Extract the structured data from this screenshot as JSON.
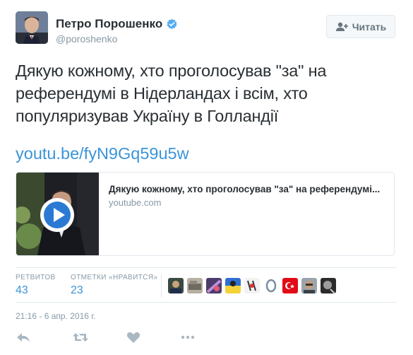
{
  "user": {
    "name": "Петро Порошенко",
    "handle": "@poroshenko",
    "verified": true,
    "avatar_icon": "avatar-photo"
  },
  "follow_button": {
    "label": "Читать",
    "icon": "follow-user-icon"
  },
  "tweet": {
    "text": "Дякую кожному, хто проголосував \"за\" на референдумі в Нідерландах і всім, хто популяризував Україну в Голландії",
    "link": "youtu.be/fyN9Gq59u5w"
  },
  "card": {
    "title": "Дякую кожному, хто проголосував \"за\" на референдумі...",
    "domain": "youtube.com",
    "thumbnail_icon": "video-thumbnail",
    "play_icon": "play-icon"
  },
  "stats": {
    "retweets_label": "РЕТВИТОВ",
    "retweets_value": "43",
    "likes_label": "ОТМЕТКИ «НРАВИТСЯ»",
    "likes_value": "23",
    "likers": [
      "liker-avatar",
      "liker-avatar",
      "liker-avatar",
      "liker-avatar",
      "liker-avatar",
      "liker-avatar",
      "liker-avatar",
      "liker-avatar",
      "liker-avatar",
      "liker-avatar"
    ]
  },
  "timestamp": "21:16 - 6 апр. 2016 г.",
  "actions": [
    "reply-icon",
    "retweet-icon",
    "like-icon",
    "more-icon"
  ],
  "colors": {
    "link": "#3b94d9",
    "muted": "#8899a6",
    "text": "#292f33",
    "border": "#e1e8ed",
    "verified": "#55acee"
  }
}
